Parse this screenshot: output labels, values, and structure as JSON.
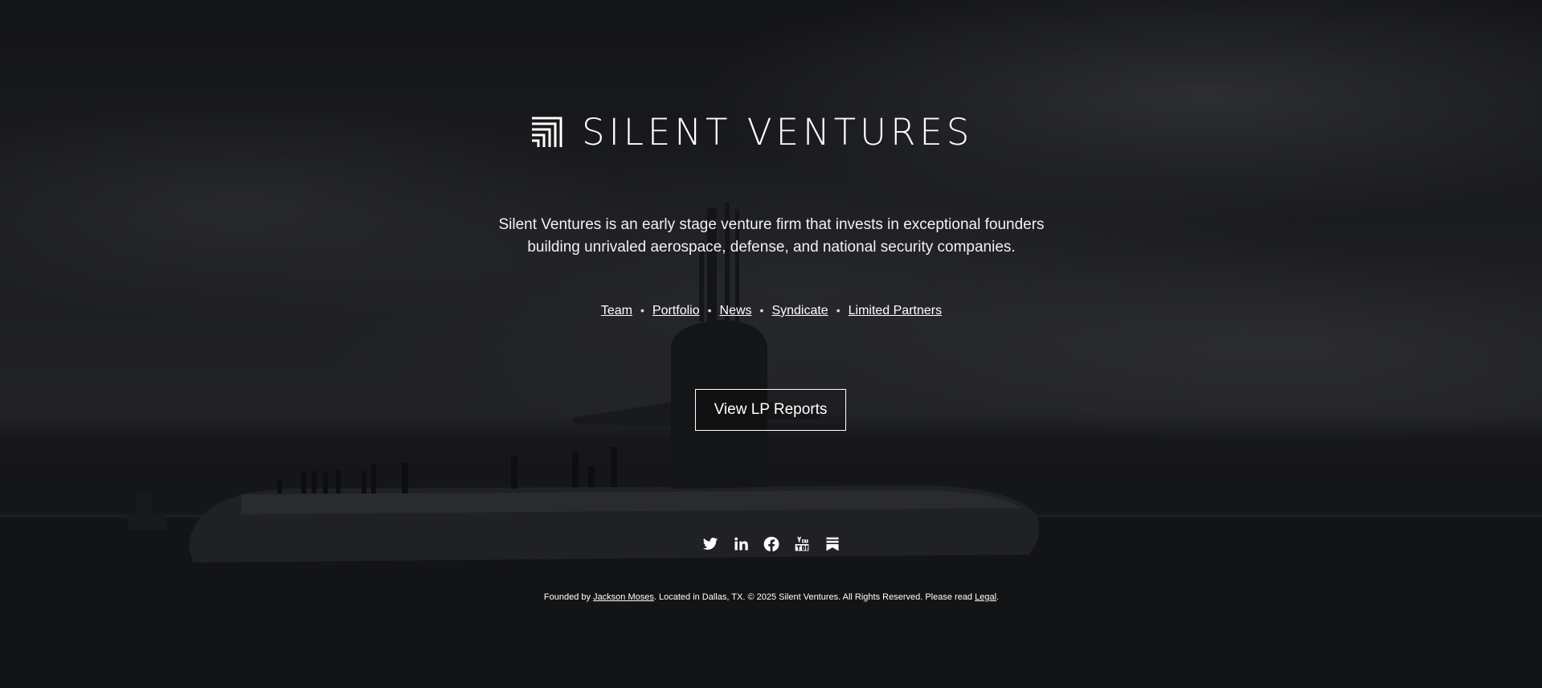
{
  "brand": {
    "name": "SILENT VENTURES",
    "tagline_line1": "Silent Ventures is an early stage venture firm that invests in exceptional founders",
    "tagline_line2": "building unrivaled aerospace, defense, and national security companies."
  },
  "nav": {
    "items": [
      {
        "label": "Team"
      },
      {
        "label": "Portfolio"
      },
      {
        "label": "News"
      },
      {
        "label": "Syndicate"
      },
      {
        "label": "Limited Partners"
      }
    ],
    "separator": "•"
  },
  "cta": {
    "label": "View LP Reports"
  },
  "social": {
    "icons": [
      "twitter-icon",
      "linkedin-icon",
      "facebook-icon",
      "youtube-icon",
      "substack-icon"
    ]
  },
  "footer": {
    "prefix": "Founded by ",
    "founder_link": "Jackson Moses",
    "middle": ". Located in Dallas, TX. © 2025 Silent Ventures. All Rights Reserved. Please read ",
    "legal_link": "Legal",
    "suffix": "."
  },
  "colors": {
    "text": "#ffffff",
    "background": "#111214"
  }
}
